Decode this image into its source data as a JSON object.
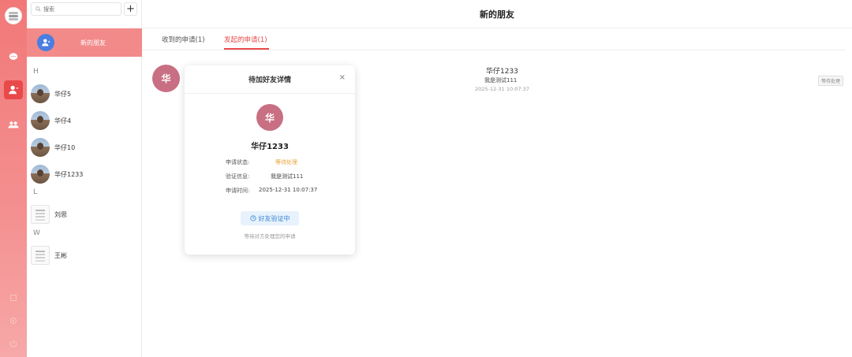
{
  "rail": {
    "icons": [
      "app-logo",
      "chat-icon",
      "contacts-icon",
      "group-icon",
      "bottom-icon-1",
      "bottom-icon-2",
      "power-icon"
    ]
  },
  "contacts": {
    "search_placeholder": "搜索",
    "add_symbol": "+",
    "new_friends_label": "新的朋友",
    "groups": [
      {
        "letter": "H",
        "items": [
          "华仔5",
          "华仔4",
          "华仔10",
          "华仔1233"
        ]
      },
      {
        "letter": "L",
        "items": [
          "刘思"
        ]
      },
      {
        "letter": "W",
        "items": [
          "王彬"
        ]
      }
    ]
  },
  "main": {
    "title": "新的朋友",
    "tabs": [
      {
        "label": "收到的申请(1)"
      },
      {
        "label": "发起的申请(1)"
      }
    ],
    "active_tab": 1,
    "request": {
      "avatar_char": "华",
      "name": "华仔1233",
      "message": "我是测试111",
      "time": "2025-12-31 10:07:37",
      "status": "等待处理"
    }
  },
  "modal": {
    "title": "待加好友详情",
    "close_symbol": "×",
    "avatar_char": "华",
    "name": "华仔1233",
    "fields": [
      {
        "key": "申请状态:",
        "value": "等待处理"
      },
      {
        "key": "验证信息:",
        "value": "我是测试111"
      },
      {
        "key": "申请时间:",
        "value": "2025-12-31 10:07:37"
      }
    ],
    "badge": "好友验证中",
    "hint": "等待对方处理您的申请"
  },
  "colors": {
    "accent": "#e84a4a",
    "rail": "#f28a8a",
    "avatar": "#c96f83",
    "pending": "#e8a33b",
    "badge_text": "#3a86d4"
  }
}
